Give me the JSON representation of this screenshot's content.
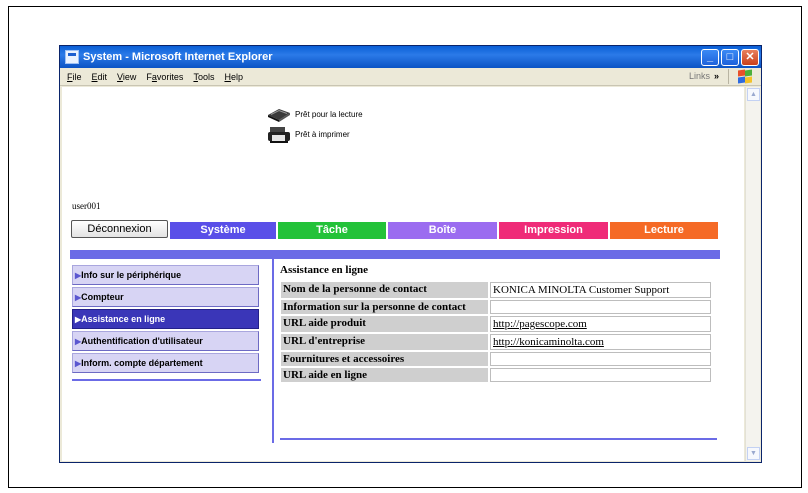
{
  "window": {
    "title": "System - Microsoft Internet Explorer",
    "minimize_glyph": "_",
    "maximize_glyph": "□",
    "close_glyph": "✕"
  },
  "menubar": {
    "items": [
      {
        "underline": "F",
        "rest": "ile"
      },
      {
        "underline": "E",
        "rest": "dit"
      },
      {
        "underline": "V",
        "rest": "iew"
      },
      {
        "pre": "F",
        "underline": "a",
        "rest": "vorites"
      },
      {
        "underline": "T",
        "rest": "ools"
      },
      {
        "underline": "H",
        "rest": "elp"
      }
    ],
    "links_label": "Links",
    "links_chevron": "»"
  },
  "status": {
    "reader_label": "Prêt pour la lecture",
    "printer_label": "Prêt à imprimer"
  },
  "user": {
    "name": "user001"
  },
  "header": {
    "logout_label": "Déconnexion",
    "tabs": [
      {
        "label": "Système",
        "color": "#5a4fe8"
      },
      {
        "label": "Tâche",
        "color": "#23c239"
      },
      {
        "label": "Boîte",
        "color": "#9b6cf0"
      },
      {
        "label": "Impression",
        "color": "#ef2b78"
      },
      {
        "label": "Lecture",
        "color": "#f56a26"
      }
    ]
  },
  "sidebar": {
    "arrow": "▶",
    "items": [
      {
        "label": "Info sur le périphérique",
        "active": false
      },
      {
        "label": "Compteur",
        "active": false
      },
      {
        "label": "Assistance en ligne",
        "active": true
      },
      {
        "label": "Authentification d'utilisateur",
        "active": false
      },
      {
        "label": "Inform. compte département",
        "active": false
      }
    ]
  },
  "panel": {
    "title": "Assistance en ligne",
    "rows": [
      {
        "key": "Nom de la personne de contact",
        "value": "KONICA MINOLTA Customer Support"
      },
      {
        "key": "Information sur la personne de contact",
        "value": ""
      },
      {
        "key": "URL aide produit",
        "value": "http://pagescope.com"
      },
      {
        "key": "URL d'entreprise",
        "value": "http://konicaminolta.com"
      },
      {
        "key": "Fournitures et accessoires",
        "value": ""
      },
      {
        "key": "URL aide en ligne",
        "value": ""
      }
    ]
  },
  "colors": {
    "accent_purple": "#6b6be6",
    "sidebar_active": "#3a36b8",
    "sidebar_bg": "#d7d4f4"
  }
}
